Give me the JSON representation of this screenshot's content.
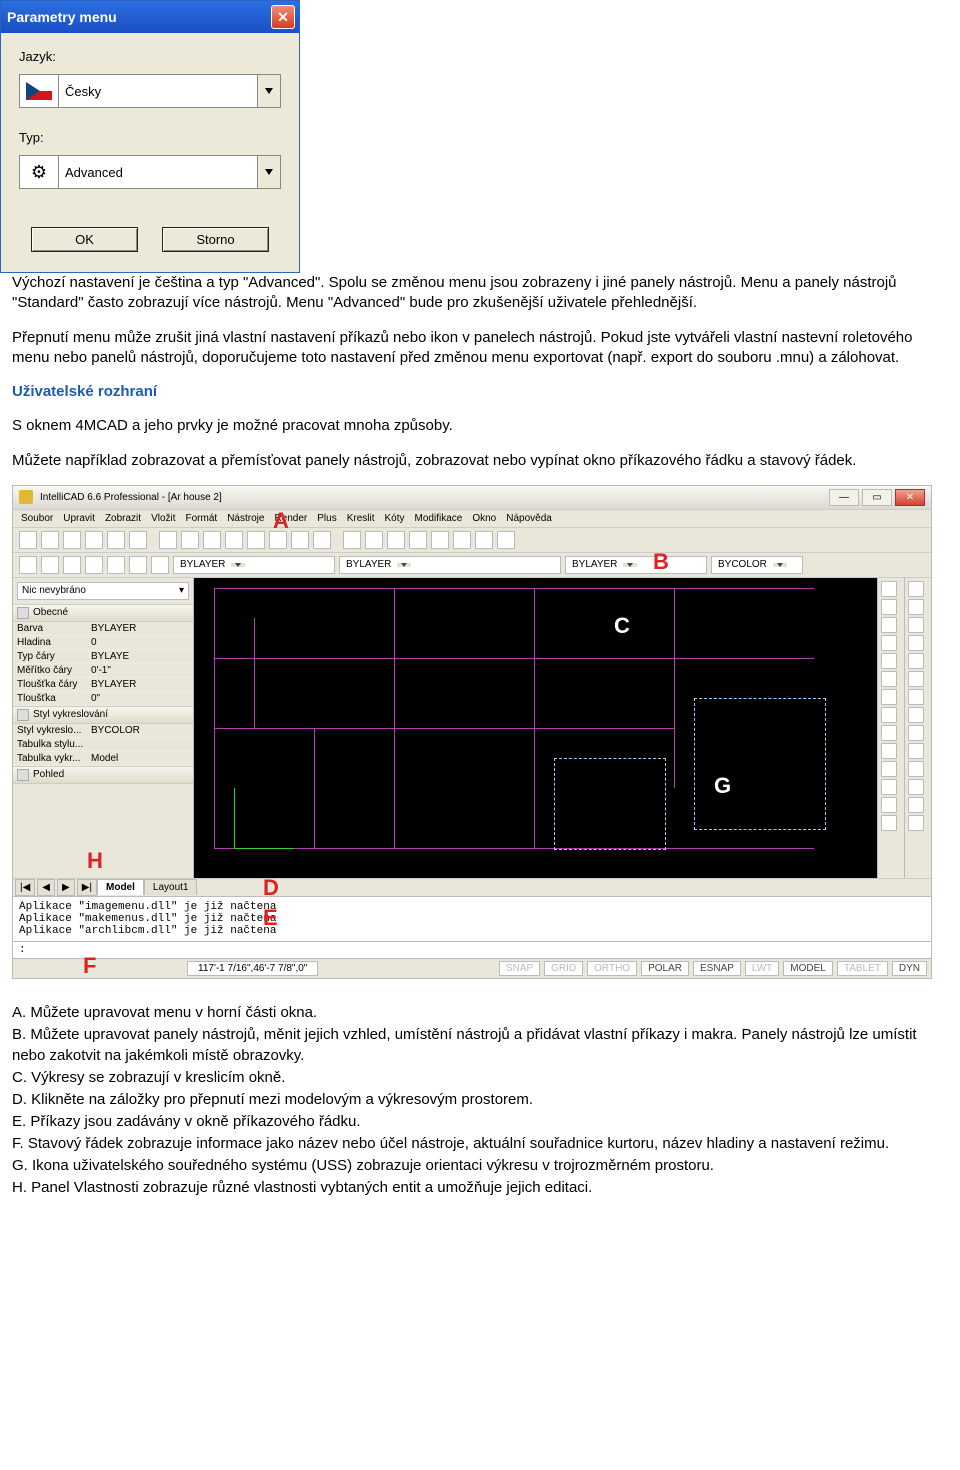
{
  "dialog": {
    "title": "Parametry menu",
    "fields": {
      "lang_label": "Jazyk:",
      "lang_value": "Česky",
      "type_label": "Typ:",
      "type_value": "Advanced"
    },
    "ok": "OK",
    "cancel": "Storno"
  },
  "paragraphs": {
    "p1": "Výchozí nastavení je čeština a typ \"Advanced\". Spolu se změnou menu jsou zobrazeny i jiné panely nástrojů. Menu a panely nástrojů \"Standard\" často zobrazují více nástrojů. Menu \"Advanced\" bude pro zkušenější uživatele přehlednější.",
    "p2": "Přepnutí menu může zrušit jiná vlastní nastavení příkazů nebo ikon v panelech nástrojů. Pokud jste vytvářeli vlastní nastevní roletového menu nebo panelů nástrojů, doporučujeme toto nastavení před změnou menu exportovat (např. export do souboru .mnu) a zálohovat.",
    "heading": "Uživatelské rozhraní",
    "p3": "S oknem 4MCAD a jeho prvky je možné pracovat mnoha způsoby.",
    "p4": "Můžete například zobrazovat a přemísťovat panely nástrojů, zobrazovat nebo vypínat okno příkazového řádku a stavový řádek."
  },
  "cad": {
    "title": "IntelliCAD 6.6 Professional - [Ar house 2]",
    "menus": [
      "Soubor",
      "Upravit",
      "Zobrazit",
      "Vložit",
      "Formát",
      "Nástroje",
      "Render",
      "Plus",
      "Kreslit",
      "Kóty",
      "Modifikace",
      "Okno",
      "Nápověda"
    ],
    "layer_selects": [
      "BYLAYER",
      "BYLAYER",
      "BYLAYER",
      "BYCOLOR"
    ],
    "side": {
      "nosel": "Nic nevybráno",
      "group1": "Obecné",
      "rows1": [
        {
          "k": "Barva",
          "v": "BYLAYER"
        },
        {
          "k": "Hladina",
          "v": "0"
        },
        {
          "k": "Typ čáry",
          "v": "BYLAYE"
        },
        {
          "k": "Měřítko čáry",
          "v": "0'-1\""
        },
        {
          "k": "Tloušťka čáry",
          "v": "BYLAYER"
        },
        {
          "k": "Tloušťka",
          "v": "0\""
        }
      ],
      "group2": "Styl vykreslování",
      "rows2": [
        {
          "k": "Styl vykreslo...",
          "v": "BYCOLOR"
        },
        {
          "k": "Tabulka stylu...",
          "v": ""
        },
        {
          "k": "Tabulka vykr...",
          "v": "Model"
        }
      ],
      "group3": "Pohled"
    },
    "tabs": {
      "nav": [
        "|◀",
        "◀",
        "▶",
        "▶|"
      ],
      "model": "Model",
      "layout": "Layout1"
    },
    "cmd": [
      "Aplikace \"imagemenu.dll\" je již načtena",
      "Aplikace \"makemenus.dll\" je již načtena",
      "Aplikace \"archlibcm.dll\" je již načtena"
    ],
    "prompt": ":",
    "status": {
      "coord": "117'-1 7/16\",46'-7 7/8\",0\"",
      "toggles": [
        "SNAP",
        "GRID",
        "ORTHO",
        "POLAR",
        "ESNAP",
        "LWT",
        "MODEL",
        "TABLET",
        "DYN"
      ]
    },
    "callouts": {
      "A": "A",
      "B": "B",
      "C": "C",
      "D": "D",
      "E": "E",
      "F": "F",
      "G": "G",
      "H": "H"
    }
  },
  "legend": {
    "A": "A. Můžete upravovat menu v horní části okna.",
    "B": "B. Můžete upravovat panely nástrojů, měnit jejich vzhled, umístění nástrojů a přidávat vlastní příkazy i makra. Panely nástrojů lze umístit nebo zakotvit na jakémkoli místě obrazovky.",
    "C": "C. Výkresy se zobrazují v kreslicím okně.",
    "D": "D. Klikněte na záložky pro přepnutí mezi modelovým a výkresovým prostorem.",
    "E": "E. Příkazy jsou zadávány v okně příkazového řádku.",
    "F": "F. Stavový řádek zobrazuje informace jako název nebo účel nástroje, aktuální souřadnice kurtoru, název hladiny a nastavení režimu.",
    "G": "G. Ikona uživatelského souředného systému (USS) zobrazuje orientaci výkresu v trojrozměrném prostoru.",
    "H": "H. Panel Vlastnosti zobrazuje různé vlastnosti vybtaných entit a umožňuje jejich editaci."
  }
}
